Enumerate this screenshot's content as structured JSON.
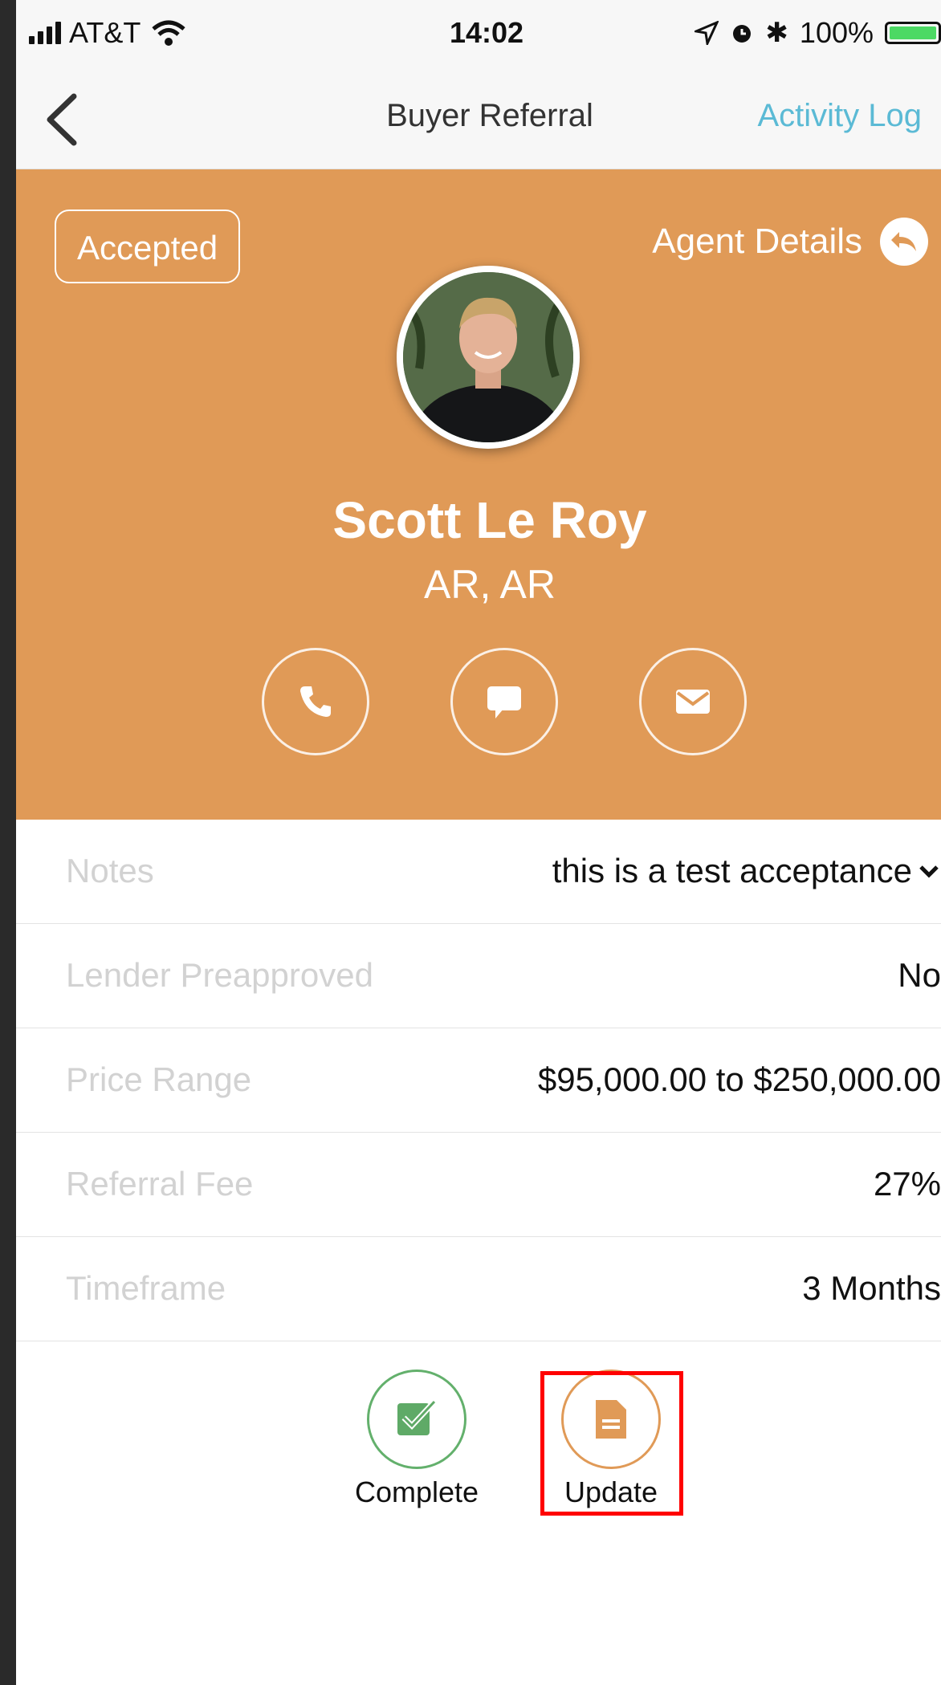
{
  "status_bar": {
    "carrier": "AT&T",
    "time": "14:02",
    "battery": "100%"
  },
  "nav": {
    "title": "Buyer Referral",
    "activity_log": "Activity Log"
  },
  "header": {
    "status": "Accepted",
    "agent_details": "Agent Details",
    "name": "Scott Le Roy",
    "location": "AR, AR",
    "background_color": "#e09a57"
  },
  "details": [
    {
      "label": "Notes",
      "value": "this is a test acceptance"
    },
    {
      "label": "Lender Preapproved",
      "value": "No"
    },
    {
      "label": "Price Range",
      "value": "$95,000.00 to $250,000.00"
    },
    {
      "label": "Referral Fee",
      "value": "27%"
    },
    {
      "label": "Timeframe",
      "value": "3 Months"
    }
  ],
  "actions": {
    "complete": "Complete",
    "update": "Update"
  }
}
